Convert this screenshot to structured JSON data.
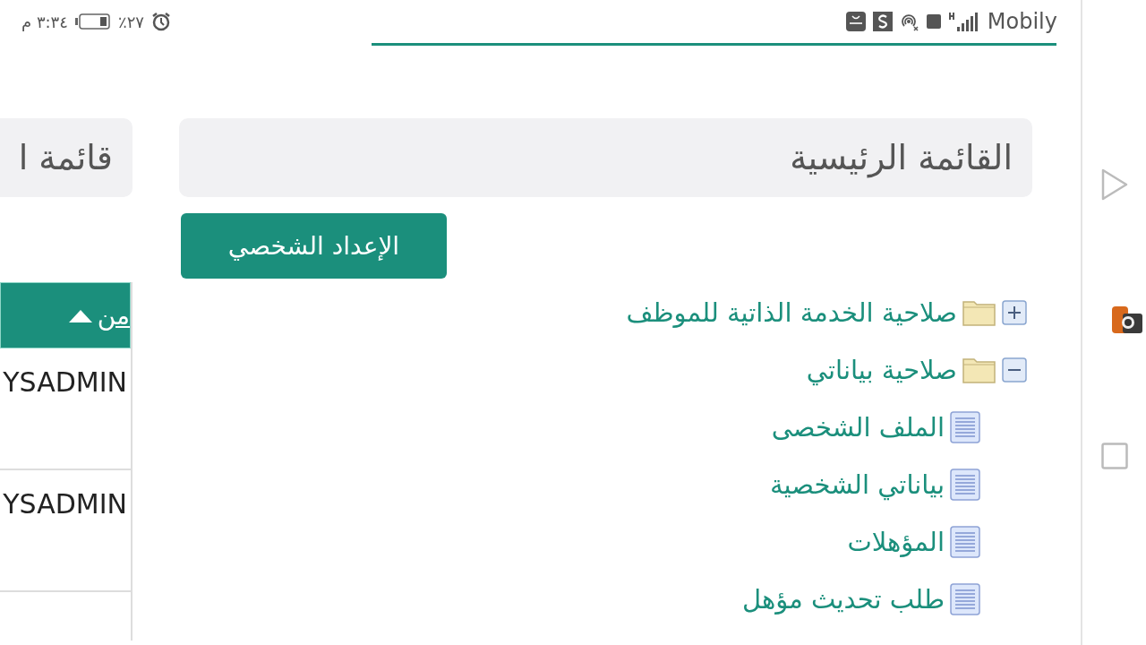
{
  "status_bar": {
    "time": "٣:٣٤ م",
    "battery": "٪٢٧",
    "carrier": "Mobily"
  },
  "side_panel": {
    "title": "قائمة ا"
  },
  "table": {
    "columns": [
      {
        "label": "من",
        "sorted_ascending": true
      }
    ],
    "rows": [
      {
        "cells": [
          "YSADMIN"
        ]
      },
      {
        "cells": [
          "YSADMIN"
        ]
      }
    ]
  },
  "main_menu": {
    "title": "القائمة الرئيسية"
  },
  "profile_button": "الإعداد الشخصي",
  "tree": [
    {
      "label": "صلاحية الخدمة الذاتية للموظف",
      "expanded": false
    },
    {
      "label": "صلاحية بياناتي",
      "expanded": true,
      "children": [
        {
          "label": "الملف الشخصى"
        },
        {
          "label": "بياناتي الشخصية"
        },
        {
          "label": "المؤهلات"
        },
        {
          "label": "طلب تحديث مؤهل"
        }
      ]
    }
  ]
}
